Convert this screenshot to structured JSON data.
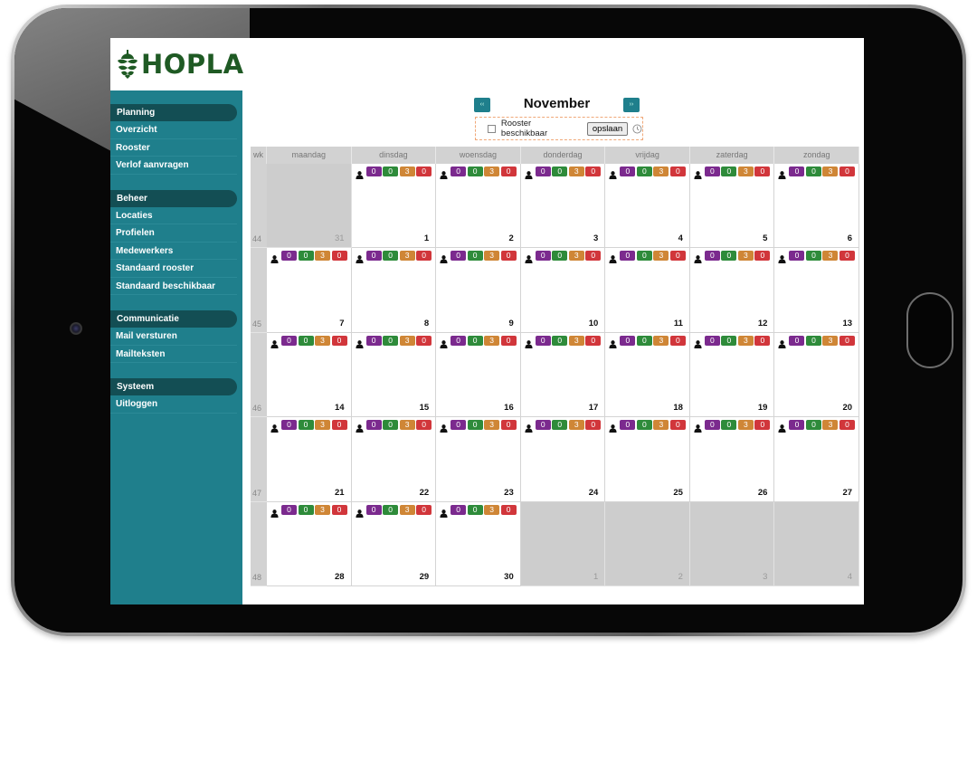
{
  "brand": {
    "name": "HOPLA",
    "color": "#1f5a24"
  },
  "colors": {
    "sidebar": "#1f7f8c",
    "sidebar_header": "#134e54",
    "badge_purple": "#7b2a8e",
    "badge_green": "#2e8b3a",
    "badge_orange": "#cf8636",
    "badge_red": "#d1363b"
  },
  "sidebar": {
    "sections": [
      {
        "title": "Planning",
        "items": [
          "Overzicht",
          "Rooster",
          "Verlof aanvragen"
        ]
      },
      {
        "title": "Beheer",
        "items": [
          "Locaties",
          "Profielen",
          "Medewerkers",
          "Standaard rooster",
          "Standaard beschikbaar"
        ]
      },
      {
        "title": "Communicatie",
        "items": [
          "Mail versturen",
          "Mailteksten"
        ]
      },
      {
        "title": "Systeem",
        "items": [
          "Uitloggen"
        ]
      }
    ]
  },
  "calendar": {
    "month": "November",
    "prev_label": "‹‹",
    "next_label": "››",
    "availability_label": "Rooster beschikbaar",
    "availability_checked": false,
    "save_label": "opslaan",
    "icons": {
      "prev": "double-chevron-left-icon",
      "next": "double-chevron-right-icon",
      "clock": "clock-icon",
      "person": "person-icon"
    },
    "headers": {
      "week": "wk",
      "days": [
        "maandag",
        "dinsdag",
        "woensdag",
        "donderdag",
        "vrijdag",
        "zaterdag",
        "zondag"
      ]
    },
    "weeks": [
      {
        "week": "44",
        "days": [
          {
            "day": "31",
            "other": true
          },
          {
            "day": "1",
            "counts": [
              0,
              0,
              3,
              0
            ]
          },
          {
            "day": "2",
            "counts": [
              0,
              0,
              3,
              0
            ]
          },
          {
            "day": "3",
            "counts": [
              0,
              0,
              3,
              0
            ]
          },
          {
            "day": "4",
            "counts": [
              0,
              0,
              3,
              0
            ]
          },
          {
            "day": "5",
            "counts": [
              0,
              0,
              3,
              0
            ]
          },
          {
            "day": "6",
            "counts": [
              0,
              0,
              3,
              0
            ]
          }
        ]
      },
      {
        "week": "45",
        "days": [
          {
            "day": "7",
            "counts": [
              0,
              0,
              3,
              0
            ]
          },
          {
            "day": "8",
            "counts": [
              0,
              0,
              3,
              0
            ]
          },
          {
            "day": "9",
            "counts": [
              0,
              0,
              3,
              0
            ]
          },
          {
            "day": "10",
            "counts": [
              0,
              0,
              3,
              0
            ]
          },
          {
            "day": "11",
            "counts": [
              0,
              0,
              3,
              0
            ]
          },
          {
            "day": "12",
            "counts": [
              0,
              0,
              3,
              0
            ]
          },
          {
            "day": "13",
            "counts": [
              0,
              0,
              3,
              0
            ]
          }
        ]
      },
      {
        "week": "46",
        "days": [
          {
            "day": "14",
            "counts": [
              0,
              0,
              3,
              0
            ]
          },
          {
            "day": "15",
            "counts": [
              0,
              0,
              3,
              0
            ]
          },
          {
            "day": "16",
            "counts": [
              0,
              0,
              3,
              0
            ]
          },
          {
            "day": "17",
            "counts": [
              0,
              0,
              3,
              0
            ]
          },
          {
            "day": "18",
            "counts": [
              0,
              0,
              3,
              0
            ]
          },
          {
            "day": "19",
            "counts": [
              0,
              0,
              3,
              0
            ]
          },
          {
            "day": "20",
            "counts": [
              0,
              0,
              3,
              0
            ]
          }
        ]
      },
      {
        "week": "47",
        "days": [
          {
            "day": "21",
            "counts": [
              0,
              0,
              3,
              0
            ]
          },
          {
            "day": "22",
            "counts": [
              0,
              0,
              3,
              0
            ]
          },
          {
            "day": "23",
            "counts": [
              0,
              0,
              3,
              0
            ]
          },
          {
            "day": "24",
            "counts": [
              0,
              0,
              3,
              0
            ]
          },
          {
            "day": "25",
            "counts": [
              0,
              0,
              3,
              0
            ]
          },
          {
            "day": "26",
            "counts": [
              0,
              0,
              3,
              0
            ]
          },
          {
            "day": "27",
            "counts": [
              0,
              0,
              3,
              0
            ]
          }
        ]
      },
      {
        "week": "48",
        "days": [
          {
            "day": "28",
            "counts": [
              0,
              0,
              3,
              0
            ]
          },
          {
            "day": "29",
            "counts": [
              0,
              0,
              3,
              0
            ]
          },
          {
            "day": "30",
            "counts": [
              0,
              0,
              3,
              0
            ]
          },
          {
            "day": "1",
            "other": true
          },
          {
            "day": "2",
            "other": true
          },
          {
            "day": "3",
            "other": true
          },
          {
            "day": "4",
            "other": true
          }
        ]
      }
    ]
  }
}
